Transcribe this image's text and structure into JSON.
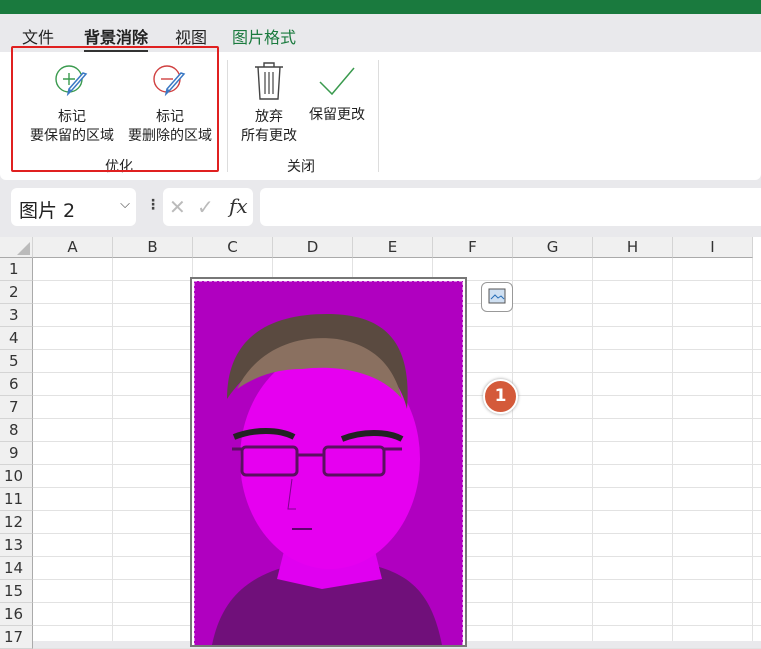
{
  "tabs": [
    "文件",
    "背景消除",
    "视图",
    "图片格式"
  ],
  "ribbon": {
    "mark_keep": {
      "line1": "标记",
      "line2": "要保留的区域"
    },
    "mark_remove": {
      "line1": "标记",
      "line2": "要删除的区域"
    },
    "group_refine": "优化",
    "discard": {
      "line1": "放弃",
      "line2": "所有更改"
    },
    "keep_changes": "保留更改",
    "group_close": "关闭"
  },
  "formula_bar": {
    "name_box": "图片 2",
    "fx": "fx",
    "value": ""
  },
  "columns": [
    "A",
    "B",
    "C",
    "D",
    "E",
    "F",
    "G",
    "H",
    "I"
  ],
  "rows": [
    "1",
    "2",
    "3",
    "4",
    "5",
    "6",
    "7",
    "8",
    "9",
    "10",
    "11",
    "12",
    "13",
    "14",
    "15",
    "16",
    "17"
  ],
  "callout": "1",
  "colors": {
    "accent": "#1a7a3e",
    "highlight": "#e02020",
    "removal_overlay": "#b000c0"
  }
}
